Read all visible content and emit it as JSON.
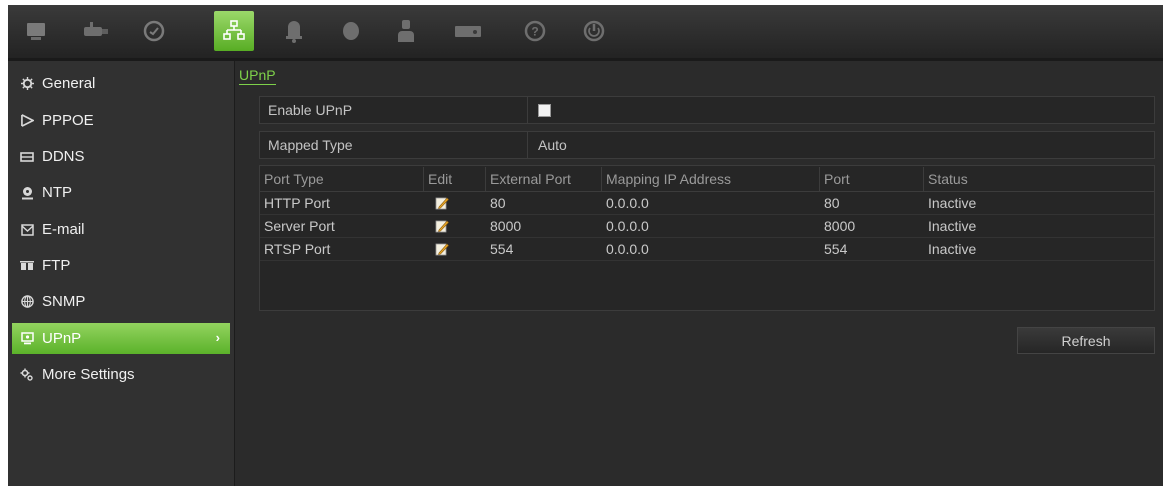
{
  "toolbar": {
    "icons": [
      "display-icon",
      "camera-icon",
      "record-icon",
      "network-icon",
      "alarm-icon",
      "device-icon",
      "user-icon",
      "system-icon",
      "help-icon",
      "power-icon"
    ],
    "active": "network-icon",
    "accent": "#6cc236"
  },
  "sidebar": {
    "items": [
      {
        "label": "General",
        "icon": "gear-icon"
      },
      {
        "label": "PPPOE",
        "icon": "pppoe-icon"
      },
      {
        "label": "DDNS",
        "icon": "ddns-icon"
      },
      {
        "label": "NTP",
        "icon": "ntp-icon"
      },
      {
        "label": "E-mail",
        "icon": "email-icon"
      },
      {
        "label": "FTP",
        "icon": "ftp-icon"
      },
      {
        "label": "SNMP",
        "icon": "snmp-icon"
      },
      {
        "label": "UPnP",
        "icon": "upnp-icon",
        "active": true,
        "chevron": "›"
      },
      {
        "label": "More Settings",
        "icon": "settings-icon"
      }
    ]
  },
  "main": {
    "section_title": "UPnP",
    "enable_upnp": {
      "label": "Enable UPnP",
      "checked": false
    },
    "mapped_type": {
      "label": "Mapped Type",
      "value": "Auto"
    },
    "table": {
      "headers": [
        "Port Type",
        "Edit",
        "External Port",
        "Mapping IP Address",
        "Port",
        "Status"
      ],
      "rows": [
        {
          "port_type": "HTTP Port",
          "external_port": "80",
          "mapping_ip": "0.0.0.0",
          "port": "80",
          "status": "Inactive"
        },
        {
          "port_type": "Server Port",
          "external_port": "8000",
          "mapping_ip": "0.0.0.0",
          "port": "8000",
          "status": "Inactive"
        },
        {
          "port_type": "RTSP Port",
          "external_port": "554",
          "mapping_ip": "0.0.0.0",
          "port": "554",
          "status": "Inactive"
        }
      ]
    },
    "refresh_label": "Refresh"
  }
}
